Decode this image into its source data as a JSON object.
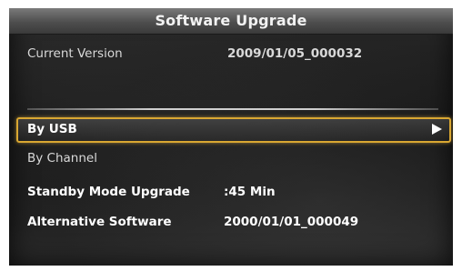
{
  "title": "Software Upgrade",
  "current_version": {
    "label": "Current Version",
    "value": "2009/01/05_000032"
  },
  "options": {
    "by_usb": "By USB",
    "by_channel": "By Channel"
  },
  "standby": {
    "label": "Standby Mode Upgrade",
    "value": ":45 Min"
  },
  "alternative": {
    "label": "Alternative Software",
    "value": "2000/01/01_000049"
  },
  "colors": {
    "highlight": "#d9a732"
  },
  "icons": {
    "selected_arrow": "right-triangle-icon"
  }
}
